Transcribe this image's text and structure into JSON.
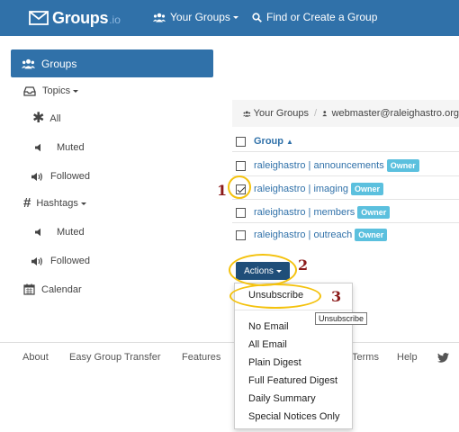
{
  "brand": {
    "name": "Groups",
    "suffix": ".io"
  },
  "nav": {
    "your_groups": "Your Groups",
    "find_create": "Find or Create a Group"
  },
  "sidebar": {
    "groups": "Groups",
    "topics": "Topics",
    "topics_all": "All",
    "topics_muted": "Muted",
    "topics_followed": "Followed",
    "hashtags": "Hashtags",
    "hashtags_muted": "Muted",
    "hashtags_followed": "Followed",
    "calendar": "Calendar"
  },
  "breadcrumb": {
    "root": "Your Groups",
    "sep": "/",
    "account": "webmaster@raleighastro.org"
  },
  "table": {
    "header": "Group",
    "rows": [
      {
        "name": "raleighastro | announcements",
        "badge": "Owner",
        "checked": false
      },
      {
        "name": "raleighastro | imaging",
        "badge": "Owner",
        "checked": true
      },
      {
        "name": "raleighastro | members",
        "badge": "Owner",
        "checked": false
      },
      {
        "name": "raleighastro | outreach",
        "badge": "Owner",
        "checked": false
      }
    ]
  },
  "actions": {
    "label": "Actions",
    "menu": [
      "Unsubscribe",
      "No Email",
      "All Email",
      "Plain Digest",
      "Full Featured Digest",
      "Daily Summary",
      "Special Notices Only"
    ]
  },
  "tooltip": "Unsubscribe",
  "footer": [
    "About",
    "Easy Group Transfer",
    "Features",
    "Terms",
    "Help"
  ],
  "annotations": [
    "1",
    "2",
    "3"
  ],
  "colors": {
    "navbar": "#3071a9",
    "accent": "#3071a9",
    "badge": "#5bc0de",
    "actions_button": "#1f4e79",
    "highlight": "#f4c20d",
    "annotation_text": "#8b1a1a"
  }
}
